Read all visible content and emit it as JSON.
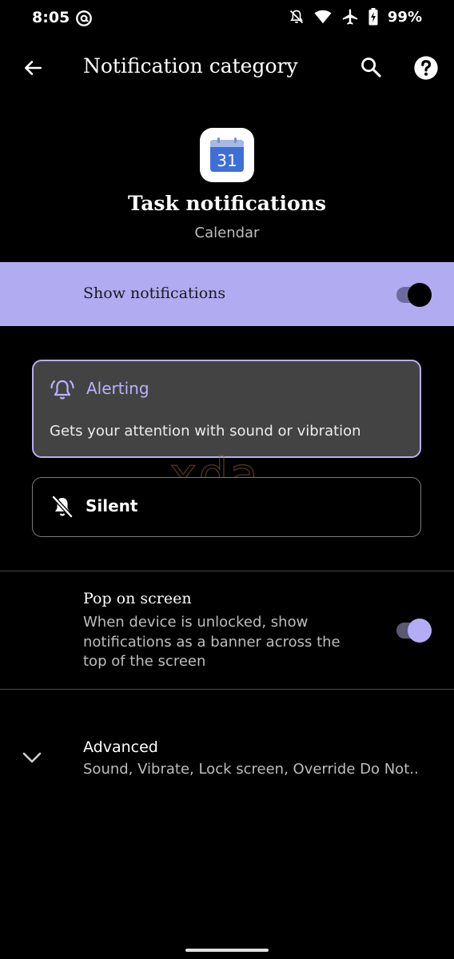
{
  "status_bar": {
    "time": "8:05",
    "battery": "99%"
  },
  "app_bar": {
    "title": "Notification category"
  },
  "header": {
    "icon_day": "31",
    "channel_name": "Task notifications",
    "app_name": "Calendar"
  },
  "show_notifications": {
    "label": "Show notifications",
    "enabled": true
  },
  "importance": {
    "alerting": {
      "title": "Alerting",
      "description": "Gets your attention with sound or vibration",
      "selected": true
    },
    "silent": {
      "title": "Silent",
      "selected": false
    }
  },
  "watermark": "xda",
  "pop_on_screen": {
    "title": "Pop on screen",
    "description": "When device is unlocked, show notifications as a banner across the top of the screen",
    "enabled": true
  },
  "advanced": {
    "title": "Advanced",
    "summary": "Sound, Vibrate, Lock screen, Override Do Not.."
  },
  "colors": {
    "accent": "#b1abf2",
    "accent_text": "#b9b2ff",
    "card_selected": "#434343",
    "background": "#000000"
  }
}
